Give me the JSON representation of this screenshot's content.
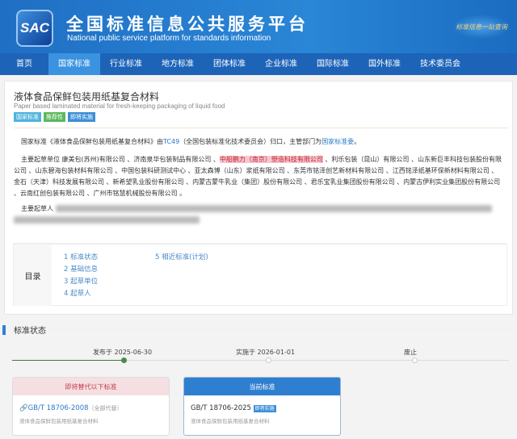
{
  "header": {
    "logo_text": "SAC",
    "title": "全国标准信息公共服务平台",
    "subtitle": "National public service platform  for standards information",
    "slogan": "标准信息一站查询"
  },
  "nav": [
    "首页",
    "国家标准",
    "行业标准",
    "地方标准",
    "团体标准",
    "企业标准",
    "国际标准",
    "国外标准",
    "技术委员会"
  ],
  "standard": {
    "title_cn": "液体食品保鲜包装用纸基复合材料",
    "title_en": "Paper based laminated material for fresh-keeping packaging of liquid food",
    "tags": [
      {
        "label": "国家标准",
        "color": "#4fb3dc"
      },
      {
        "label": "推荐性",
        "color": "#5cb85c"
      },
      {
        "label": "即将实施",
        "color": "#3d8fd6"
      }
    ]
  },
  "intro": {
    "prefix": "国家标准《液体食品保鲜包装用纸基复合材料》由",
    "tc": "TC49",
    "mid": "（全国包装标准化技术委员会）归口，主管部门为",
    "dept": "国家标准委",
    "suffix": "。"
  },
  "drafting": {
    "label": "主要起草单位",
    "before": " 康美包(苏州)有限公司 、济南泉华包装制品有限公司 、",
    "highlight": "中船鹏力（南京）塑造科技有限公司",
    "after": " 、利乐包装（昆山）有限公司 、山东新巨丰科技包装股份有限公司 、山东碧海包装材料有限公司 、中国包装科研测试中心 、亚太森博（山东）浆纸有限公司 、东莞市铭泽创艺新材料有限公司 、江西铭泽纸基环保新材料有限公司 、金石（天津）科技发展有限公司 、新希望乳业股份有限公司 、内蒙古蒙牛乳业（集团）股份有限公司 、君乐宝乳业集团股份有限公司 、内蒙古伊利实业集团股份有限公司 、云南红创包装有限公司 、广州市铭慧机械股份有限公司 。"
  },
  "drafters": {
    "label": "主要起草人"
  },
  "toc": {
    "label": "目录",
    "items": [
      "1  标准状态",
      "2  基础信息",
      "3  起草单位",
      "4  起草人",
      "5  相近标准(计划)"
    ]
  },
  "status": {
    "title": "标准状态",
    "steps": [
      {
        "label": "发布于 2025-06-30",
        "done": true
      },
      {
        "label": "实施于 2026-01-01",
        "done": false
      },
      {
        "label": "废止",
        "done": false
      }
    ]
  },
  "replaces": {
    "header": "即将替代以下标准",
    "code": "GB/T 18706-2008",
    "note": "（全部代替）",
    "name": "液体食品保鲜包装用纸基复合材料"
  },
  "current": {
    "header": "当前标准",
    "code": "GB/T 18706-2025",
    "badge": "即将实施",
    "name": "液体食品保鲜包装用纸基复合材料"
  }
}
